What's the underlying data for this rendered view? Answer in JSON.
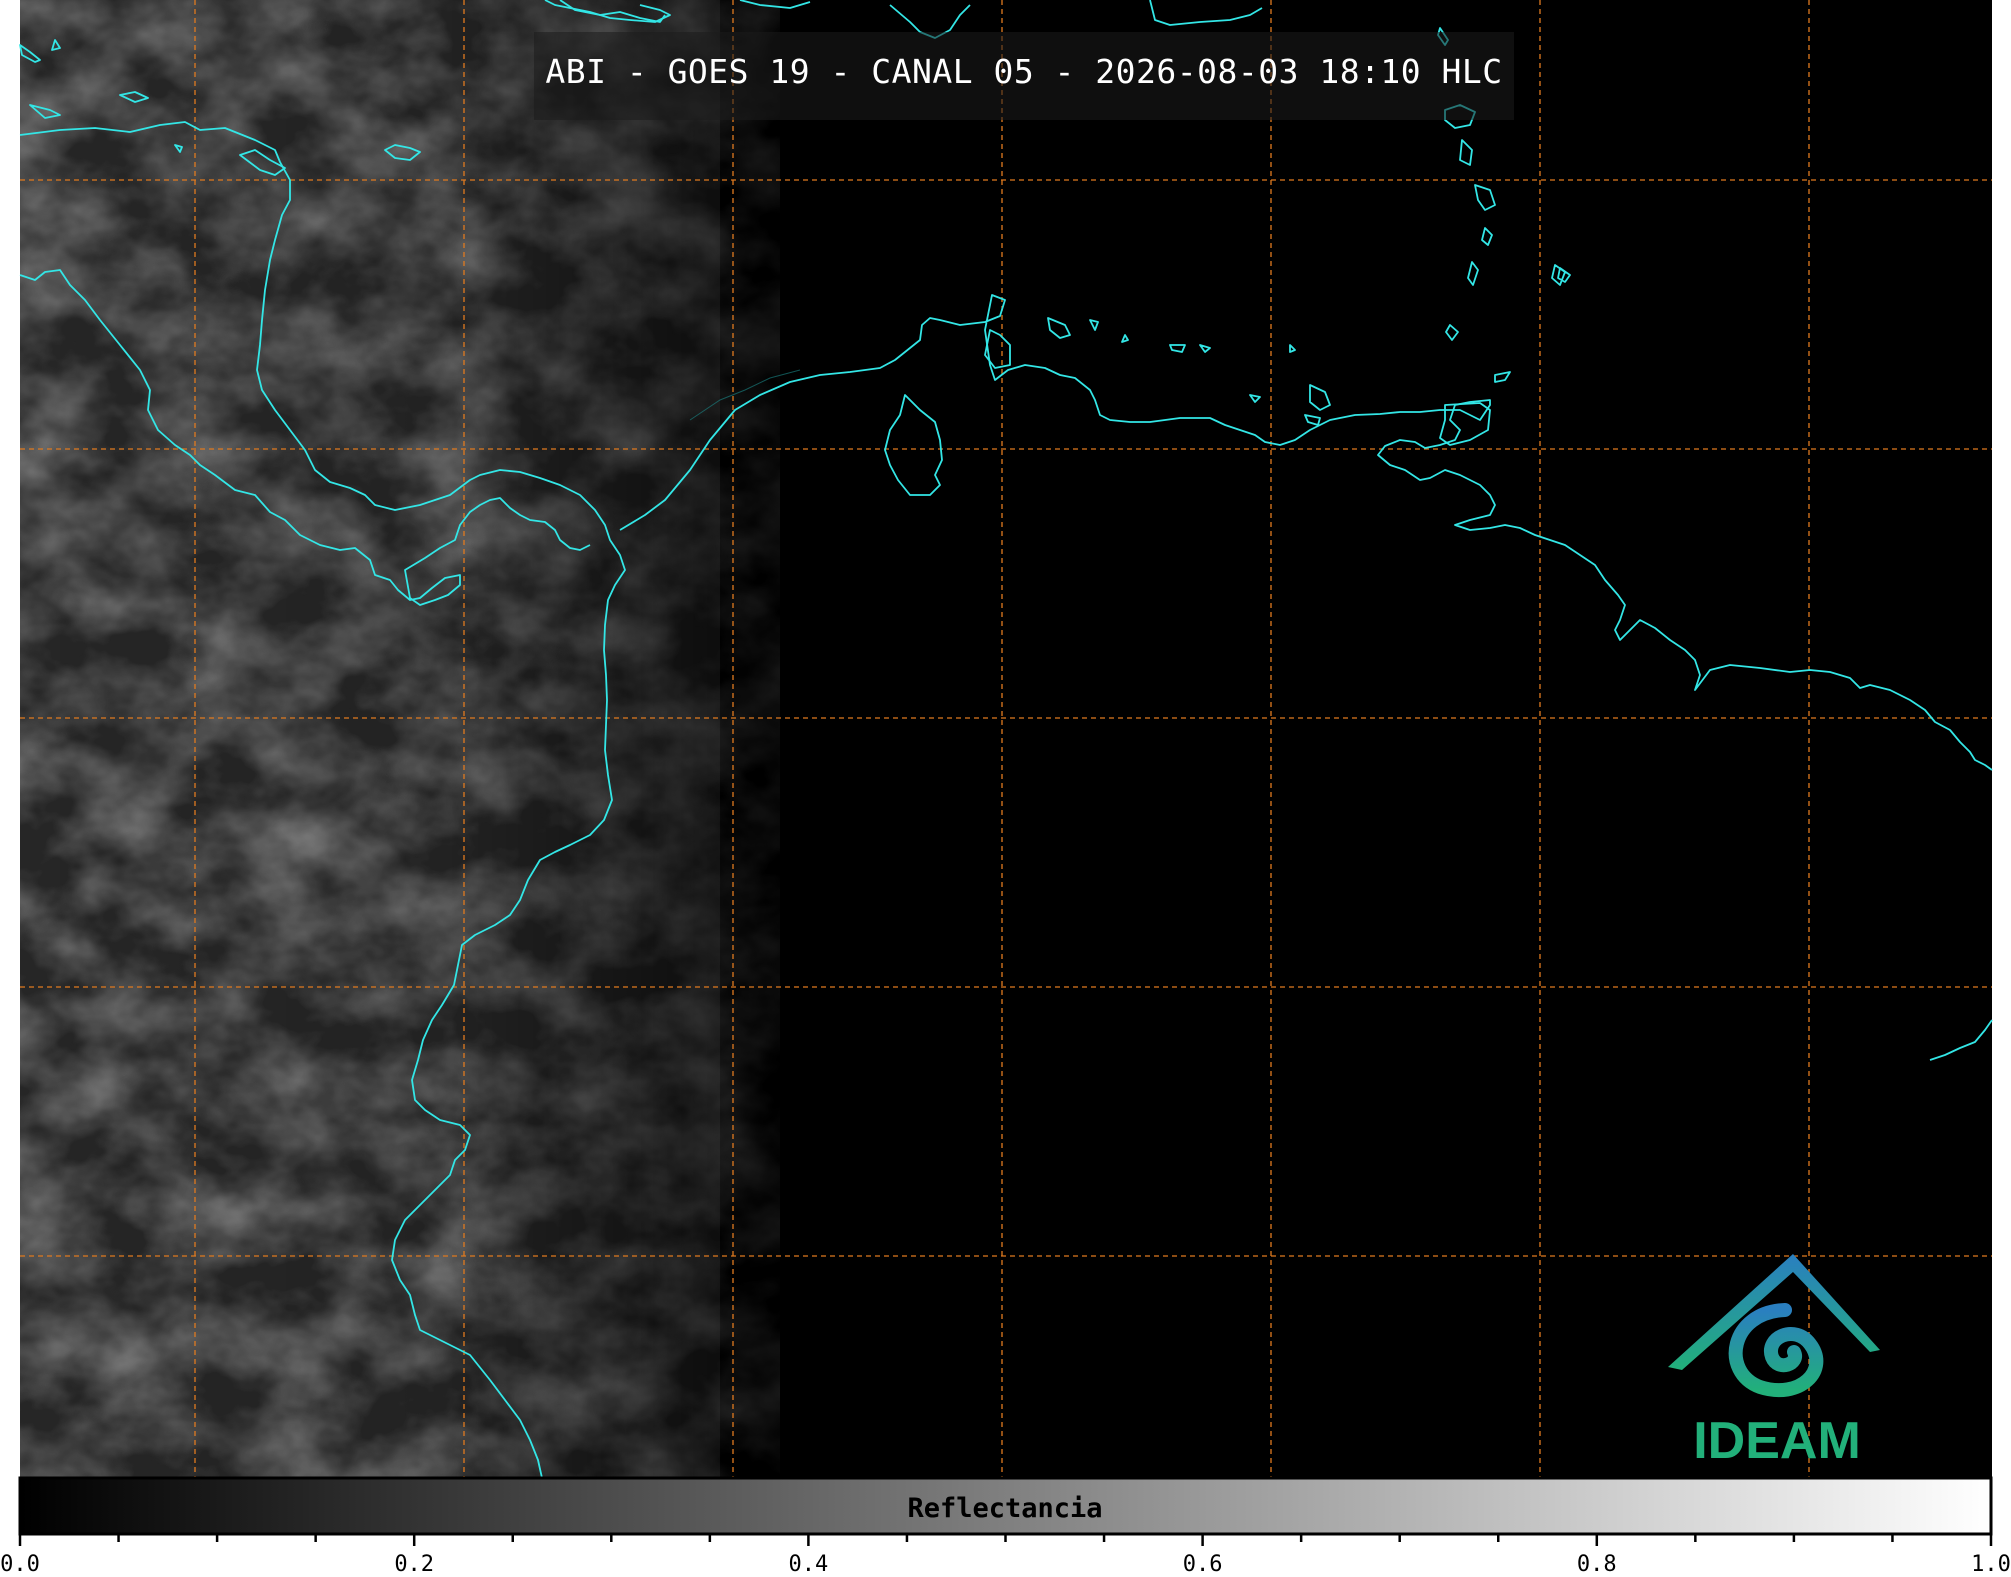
{
  "title": "ABI - GOES 19 - CANAL 05 - 2026-08-03 18:10 HLC",
  "colorbar": {
    "label": "Reflectancia",
    "min": 0.0,
    "max": 1.0,
    "tick_labels": [
      "0.0",
      "0.2",
      "0.4",
      "0.6",
      "0.8",
      "1.0"
    ],
    "colormap": [
      "#000000",
      "#ffffff"
    ]
  },
  "map": {
    "coastline_color": "#33e6e6",
    "gridline_color": "#e07a1f",
    "background_color": "#000000"
  },
  "logo": {
    "text": "IDEAM",
    "colors": [
      "#2a7fc0",
      "#22b07a"
    ]
  }
}
